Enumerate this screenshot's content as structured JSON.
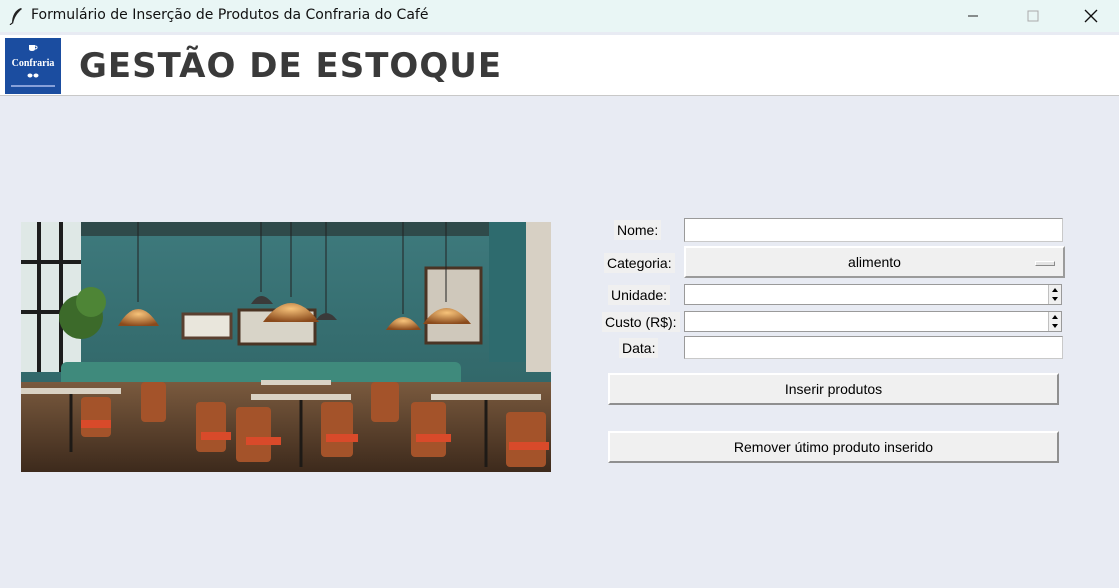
{
  "window": {
    "title": "Formulário de Inserção de Produtos da Confraria do Café",
    "icon": "feather-icon"
  },
  "header": {
    "logo_text": "Confraria",
    "heading": "GESTÃO DE ESTOQUE"
  },
  "form": {
    "nome_label": "Nome:",
    "nome_value": "",
    "categoria_label": "Categoria:",
    "categoria_value": "alimento",
    "unidade_label": "Unidade:",
    "unidade_value": "",
    "custo_label": "Custo (R$):",
    "custo_value": "",
    "data_label": "Data:",
    "data_value": ""
  },
  "buttons": {
    "insert": "Inserir produtos",
    "remove": "Remover útimo produto inserido"
  },
  "colors": {
    "window_bg": "#e8ebf3",
    "titlebar_bg": "#e9f6f5",
    "logo_bg": "#1b4da0"
  }
}
